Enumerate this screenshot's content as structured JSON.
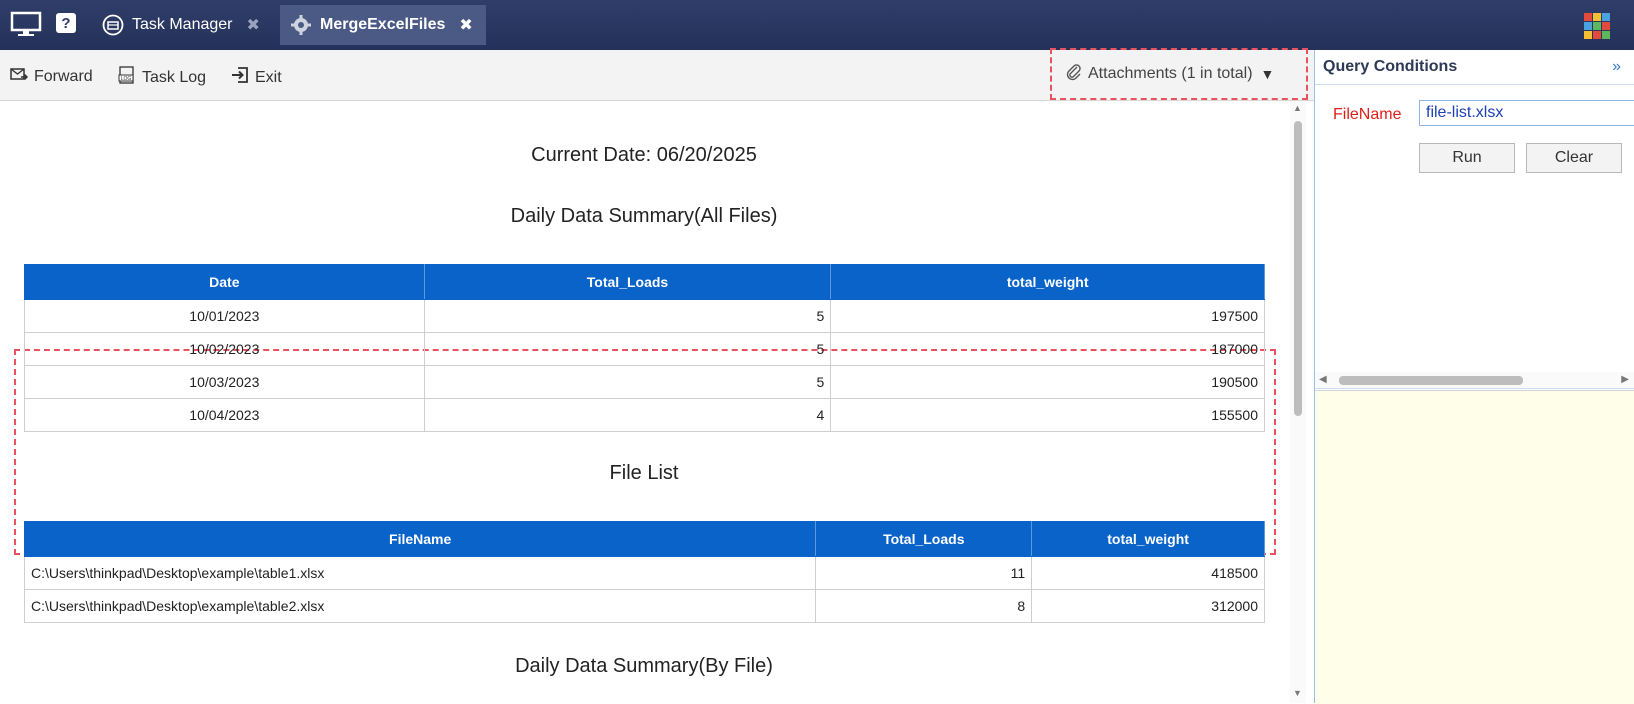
{
  "titlebar": {
    "tabs": [
      {
        "label": "Task Manager",
        "active": false
      },
      {
        "label": "MergeExcelFiles",
        "active": true
      }
    ]
  },
  "toolbar": {
    "forward": "Forward",
    "task_log": "Task Log",
    "exit": "Exit",
    "attachments": "Attachments (1 in total)"
  },
  "report": {
    "current_date": "Current Date: 06/20/2025",
    "summary_all_title": "Daily Data Summary(All Files)",
    "summary_all": {
      "headers": [
        "Date",
        "Total_Loads",
        "total_weight"
      ],
      "rows": [
        [
          "10/01/2023",
          "5",
          "197500"
        ],
        [
          "10/02/2023",
          "5",
          "187000"
        ],
        [
          "10/03/2023",
          "5",
          "190500"
        ],
        [
          "10/04/2023",
          "4",
          "155500"
        ]
      ]
    },
    "file_list_title": "File List",
    "file_list": {
      "headers": [
        "FileName",
        "Total_Loads",
        "total_weight"
      ],
      "rows": [
        [
          "C:\\Users\\thinkpad\\Desktop\\example\\table1.xlsx",
          "11",
          "418500"
        ],
        [
          "C:\\Users\\thinkpad\\Desktop\\example\\table2.xlsx",
          "8",
          "312000"
        ]
      ]
    },
    "summary_by_file_title": "Daily Data Summary(By File)"
  },
  "query": {
    "title": "Query Conditions",
    "filename_label": "FileName",
    "filename_value": "file-list.xlsx",
    "run": "Run",
    "clear": "Clear"
  },
  "colors": {
    "header_blue": "#0a63c9",
    "titlebar": "#2f3e69",
    "highlight_dash": "#e8525e",
    "label_red": "#e0201b"
  }
}
